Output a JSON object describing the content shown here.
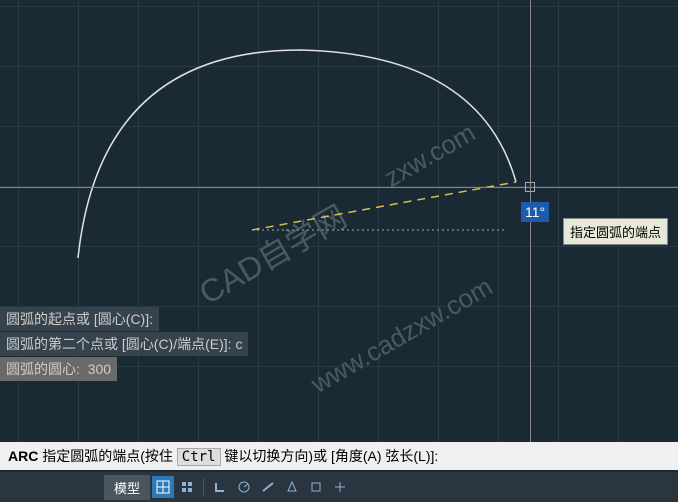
{
  "drawing": {
    "angle_value": "11",
    "angle_unit": "°",
    "tooltip": "指定圆弧的端点"
  },
  "watermarks": {
    "w1": "CAD自学网",
    "w2": "www.cadzxw.com",
    "w3": "zxw.com"
  },
  "history": {
    "line1_prefix": "圆弧的起点或 [圆心(C)]:",
    "line2_prefix": "圆弧的第二个点或 [圆心(C)/端点(E)]:",
    "line2_value": "c",
    "line3_prefix": "圆弧的圆心:",
    "line3_value": "300"
  },
  "command_bar": {
    "cmd": "ARC",
    "text1": "指定圆弧的端点(按住",
    "key": "Ctrl",
    "text2": "键以切换方向)或 [角度(A) 弦长(L)]:"
  },
  "status": {
    "model_label": "模型"
  }
}
